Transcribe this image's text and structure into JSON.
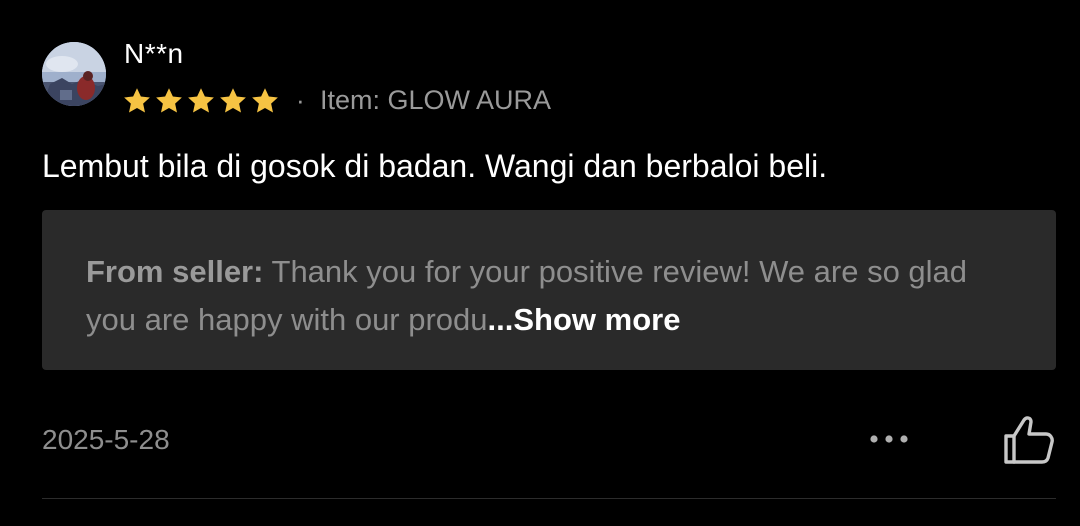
{
  "review": {
    "username": "N**n",
    "rating": 5,
    "rating_max": 5,
    "separator": "·",
    "item_label": "Item: GLOW AURA",
    "text": "Lembut bila di gosok di badan. Wangi dan berbaloi beli.",
    "seller_reply": {
      "label": "From seller:",
      "text": " Thank you for your positive review! We are so glad you are happy with our produ",
      "ellipsis_link": "...Show more"
    },
    "date": "2025-5-28",
    "actions": {
      "more_icon": "more-horizontal-icon",
      "like_icon": "thumbs-up-icon"
    }
  },
  "colors": {
    "background": "#000000",
    "star": "#F6C343",
    "muted_text": "#8E8E8E",
    "seller_box_bg": "#2A2A2A",
    "primary_text": "#FFFFFF"
  }
}
